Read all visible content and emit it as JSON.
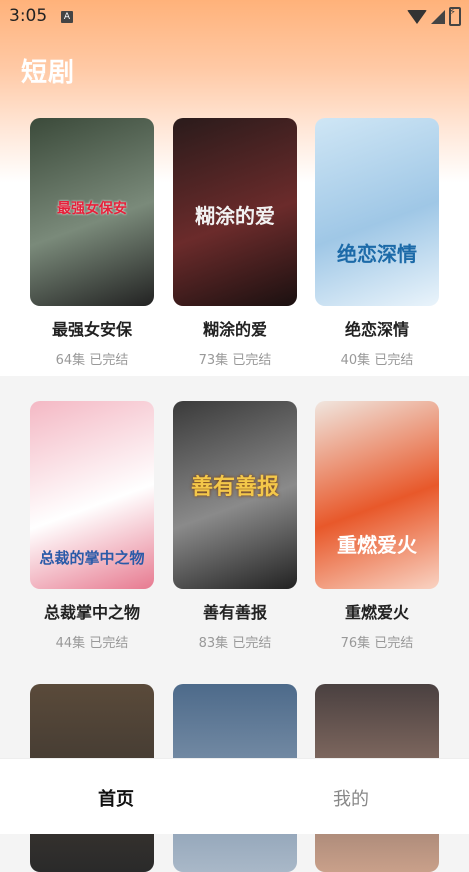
{
  "status_bar": {
    "time": "3:05",
    "notification_icon": "A"
  },
  "header": {
    "title": "短剧"
  },
  "dramas": [
    {
      "title": "最强女安保",
      "episodes": "64集",
      "status": "已完结",
      "poster_text": "最强女保安",
      "poster_colors": [
        "#3b4a3a",
        "#7a8a7a",
        "#222"
      ]
    },
    {
      "title": "糊涂的爱",
      "episodes": "73集",
      "status": "已完结",
      "poster_text": "糊涂的爱",
      "poster_colors": [
        "#2a1b1b",
        "#6b2b2b",
        "#1a1010"
      ]
    },
    {
      "title": "绝恋深情",
      "episodes": "40集",
      "status": "已完结",
      "poster_text": "绝恋深情",
      "poster_colors": [
        "#cfe6f5",
        "#9fc7e6",
        "#eaf4fb"
      ]
    },
    {
      "title": "总裁掌中之物",
      "episodes": "44集",
      "status": "已完结",
      "poster_text": "总裁的掌中之物",
      "poster_colors": [
        "#f4b8c4",
        "#ffffff",
        "#e77a90"
      ]
    },
    {
      "title": "善有善报",
      "episodes": "83集",
      "status": "已完结",
      "poster_text": "善有善报",
      "poster_colors": [
        "#3a3a3a",
        "#8a8a8a",
        "#222"
      ]
    },
    {
      "title": "重燃爱火",
      "episodes": "76集",
      "status": "已完结",
      "poster_text": "重燃爱火",
      "poster_colors": [
        "#f0e6df",
        "#e8582a",
        "#f9d3c3"
      ]
    }
  ],
  "partial_posters": [
    {
      "colors": [
        "#5a4a3a",
        "#2a2a2a"
      ]
    },
    {
      "colors": [
        "#4d6a8a",
        "#a9b8c8"
      ]
    },
    {
      "colors": [
        "#4a4040",
        "#c9a08a"
      ]
    }
  ],
  "bottom_nav": {
    "home": "首页",
    "mine": "我的"
  }
}
